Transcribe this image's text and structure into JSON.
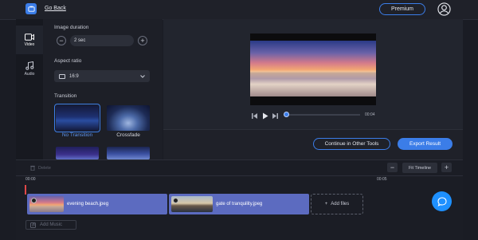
{
  "header": {
    "back_label": "Go Back",
    "premium_label": "Premium"
  },
  "rail": {
    "items": [
      {
        "label": "Video",
        "icon": "video-camera-icon",
        "active": true
      },
      {
        "label": "Audio",
        "icon": "music-note-icon",
        "active": false
      }
    ]
  },
  "settings": {
    "duration_label": "Image duration",
    "duration_value": "2 sec",
    "aspect_label": "Aspect ratio",
    "aspect_value": "16:9",
    "transition_label": "Transition",
    "transitions": [
      {
        "name": "No Transition",
        "selected": true
      },
      {
        "name": "Crossfade",
        "selected": false
      }
    ]
  },
  "player": {
    "current_time": "00:04",
    "progress": 0.0
  },
  "actions": {
    "continue_label": "Continue in Other Tools",
    "export_label": "Export Result"
  },
  "timeline": {
    "delete_label": "Delete",
    "fit_label": "Fit Timeline",
    "ruler": [
      "00:00",
      "00:05"
    ],
    "clips": [
      {
        "name": "evening beach.jpeg"
      },
      {
        "name": "gate of tranquility.jpeg"
      }
    ],
    "add_files_label": "Add files",
    "add_music_label": "Add Music"
  },
  "colors": {
    "accent": "#3b7de8",
    "clip": "#5c6bc0",
    "playhead_line": "#e04848"
  }
}
